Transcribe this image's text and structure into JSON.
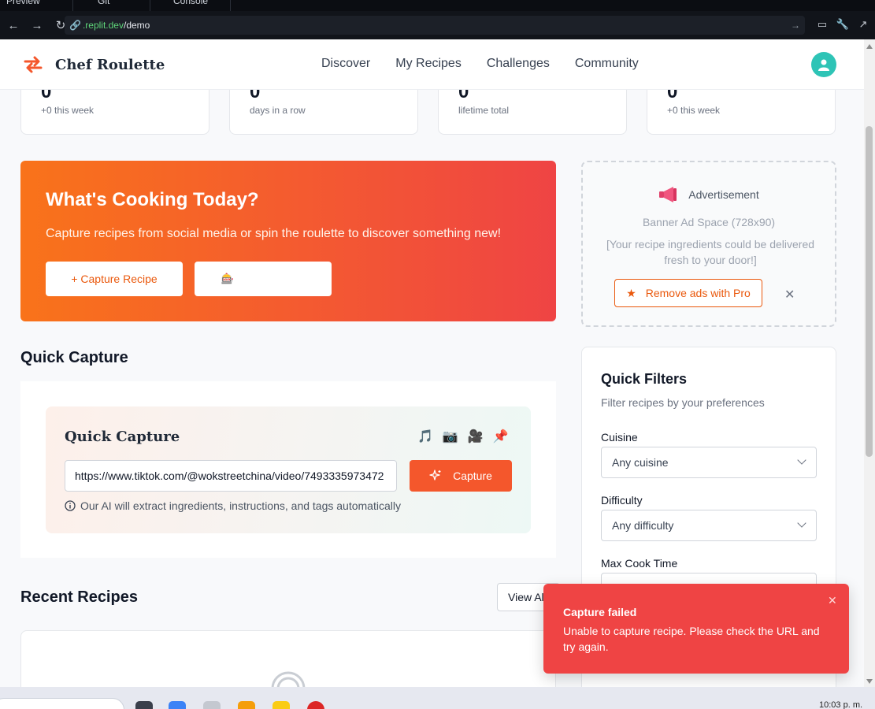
{
  "browser": {
    "tabs": [
      "Preview",
      "Git",
      "Console"
    ],
    "url_host": ".replit.dev",
    "url_path": "/demo"
  },
  "header": {
    "app_name": "Chef Roulette",
    "nav": [
      "Discover",
      "My Recipes",
      "Challenges",
      "Community"
    ]
  },
  "stats": [
    {
      "value": "0",
      "label": "+0 this week"
    },
    {
      "value": "0",
      "label": "days in a row"
    },
    {
      "value": "0",
      "label": "lifetime total"
    },
    {
      "value": "0",
      "label": "+0 this week"
    }
  ],
  "hero": {
    "title": "What's Cooking Today?",
    "subtitle": "Capture recipes from social media or spin the roulette to discover something new!",
    "capture_button": "+ Capture Recipe",
    "roulette_icon": "🎰"
  },
  "ad": {
    "label": "Advertisement",
    "size_text": "Banner Ad Space (728x90)",
    "message": "[Your recipe ingredients could be delivered fresh to your door!]",
    "pro_button": "Remove ads with Pro",
    "close_glyph": "✕",
    "accent_color": "#ea580c"
  },
  "quick_capture": {
    "section_title": "Quick Capture",
    "card_title": "Quick Capture",
    "source_icons": [
      "🎵",
      "📷",
      "🎥",
      "📌"
    ],
    "url_value": "https://www.tiktok.com/@wokstreetchina/video/7493335973472",
    "button_label": "Capture",
    "hint": "Our AI will extract ingredients, instructions, and tags automatically"
  },
  "recent": {
    "title": "Recent Recipes",
    "view_all": "View All"
  },
  "filters": {
    "title": "Quick Filters",
    "description": "Filter recipes by your preferences",
    "cuisine_label": "Cuisine",
    "cuisine_value": "Any cuisine",
    "difficulty_label": "Difficulty",
    "difficulty_value": "Any difficulty",
    "cook_time_label": "Max Cook Time"
  },
  "toast": {
    "title": "Capture failed",
    "message": "Unable to capture recipe. Please check the URL and try again.",
    "close_glyph": "✕",
    "color": "#ef4444"
  },
  "taskbar": {
    "clock": "10:03 p. m."
  },
  "colors": {
    "brand_orange": "#f9731a",
    "brand_red": "#ef4444",
    "capture_button": "#f4572c",
    "avatar": "#2ec4b6"
  }
}
